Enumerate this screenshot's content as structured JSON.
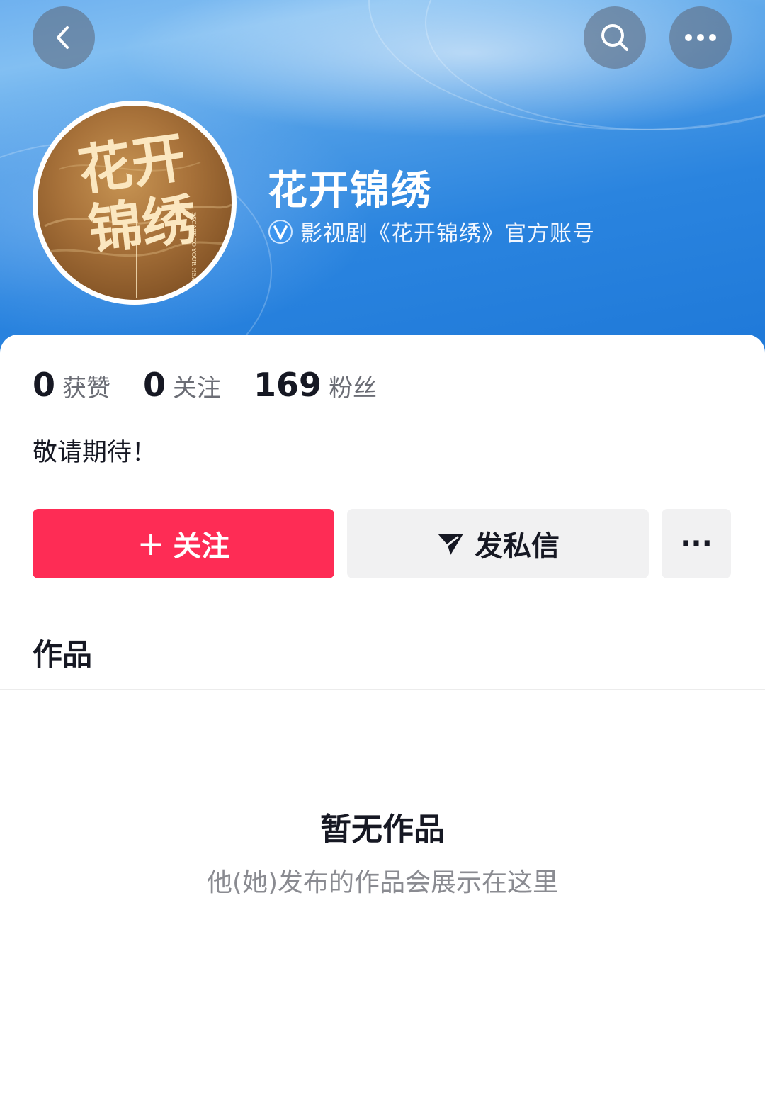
{
  "header": {
    "back_icon": "chevron-left-icon",
    "search_icon": "search-icon",
    "more_icon": "more-dots-icon"
  },
  "profile": {
    "avatar_title_line1": "花开",
    "avatar_title_line2": "锦绣",
    "avatar_subtitle": "ESCAPE TO YOUR HEART",
    "name": "花开锦绣",
    "verify_icon": "verified-badge-icon",
    "verify_text": "影视剧《花开锦绣》官方账号"
  },
  "stats": [
    {
      "value": "0",
      "label": "获赞"
    },
    {
      "value": "0",
      "label": "关注"
    },
    {
      "value": "169",
      "label": "粉丝"
    }
  ],
  "bio": "敬请期待！",
  "actions": {
    "follow_plus": "+",
    "follow_label": "关注",
    "message_icon": "send-icon",
    "message_label": "发私信",
    "more_label": "···"
  },
  "works": {
    "section_title": "作品",
    "empty_title": "暂无作品",
    "empty_subtitle": "他(她)发布的作品会展示在这里"
  },
  "colors": {
    "accent": "#fe2c55",
    "header_blue": "#2a84df"
  }
}
